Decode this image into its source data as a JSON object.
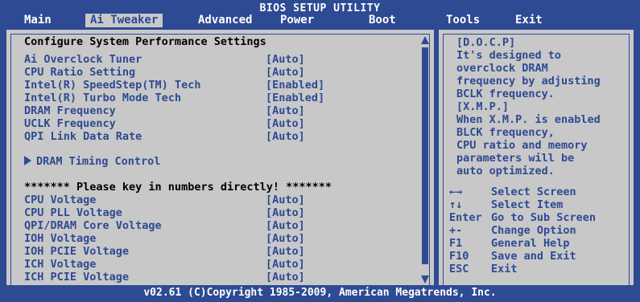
{
  "bios_title": "BIOS SETUP UTILITY",
  "menus": [
    "Main",
    "Ai Tweaker",
    "Advanced",
    "Power",
    "Boot",
    "Tools",
    "Exit"
  ],
  "active_menu": "Ai Tweaker",
  "section_heading": "Configure System Performance Settings",
  "settings": [
    {
      "label": "Ai Overclock Tuner",
      "value": "[Auto]"
    },
    {
      "label": "CPU Ratio Setting",
      "value": "[Auto]"
    },
    {
      "label": "Intel(R) SpeedStep(TM) Tech",
      "value": "[Enabled]"
    },
    {
      "label": "Intel(R) Turbo Mode Tech",
      "value": "[Enabled]"
    },
    {
      "label": "DRAM Frequency",
      "value": "[Auto]"
    },
    {
      "label": "UCLK Frequency",
      "value": "[Auto]"
    },
    {
      "label": "QPI Link Data Rate",
      "value": "[Auto]"
    }
  ],
  "submenu": "DRAM Timing Control",
  "notice": "******* Please key in numbers directly! *******",
  "voltages": [
    {
      "label": "CPU Voltage",
      "value": "[Auto]"
    },
    {
      "label": "CPU PLL Voltage",
      "value": "[Auto]"
    },
    {
      "label": "QPI/DRAM Core Voltage",
      "value": "[Auto]"
    },
    {
      "label": "IOH Voltage",
      "value": "[Auto]"
    },
    {
      "label": "IOH PCIE Voltage",
      "value": "[Auto]"
    },
    {
      "label": "ICH Voltage",
      "value": "[Auto]"
    },
    {
      "label": "ICH PCIE Voltage",
      "value": "[Auto]"
    }
  ],
  "help_text": [
    "[D.O.C.P]",
    "It's designed to",
    "overclock DRAM",
    "frequency by adjusting",
    "BCLK frequency.",
    "[X.M.P.]",
    "When X.M.P. is enabled",
    "BLCK frequency,",
    "CPU ratio and memory",
    "parameters will be",
    "auto optimized."
  ],
  "key_help": [
    {
      "key": "←→",
      "action": "Select Screen"
    },
    {
      "key": "↑↓",
      "action": "Select Item"
    },
    {
      "key": "Enter",
      "action": "Go to Sub Screen"
    },
    {
      "key": "+-",
      "action": "Change Option"
    },
    {
      "key": "F1",
      "action": "General Help"
    },
    {
      "key": "F10",
      "action": "Save and Exit"
    },
    {
      "key": "ESC",
      "action": "Exit"
    }
  ],
  "footer": "v02.61 (C)Copyright 1985-2009, American Megatrends, Inc.",
  "colors": {
    "bios_blue": "#2d4a93",
    "panel_grey": "#c8c8c8",
    "text_white": "#ffffff"
  }
}
